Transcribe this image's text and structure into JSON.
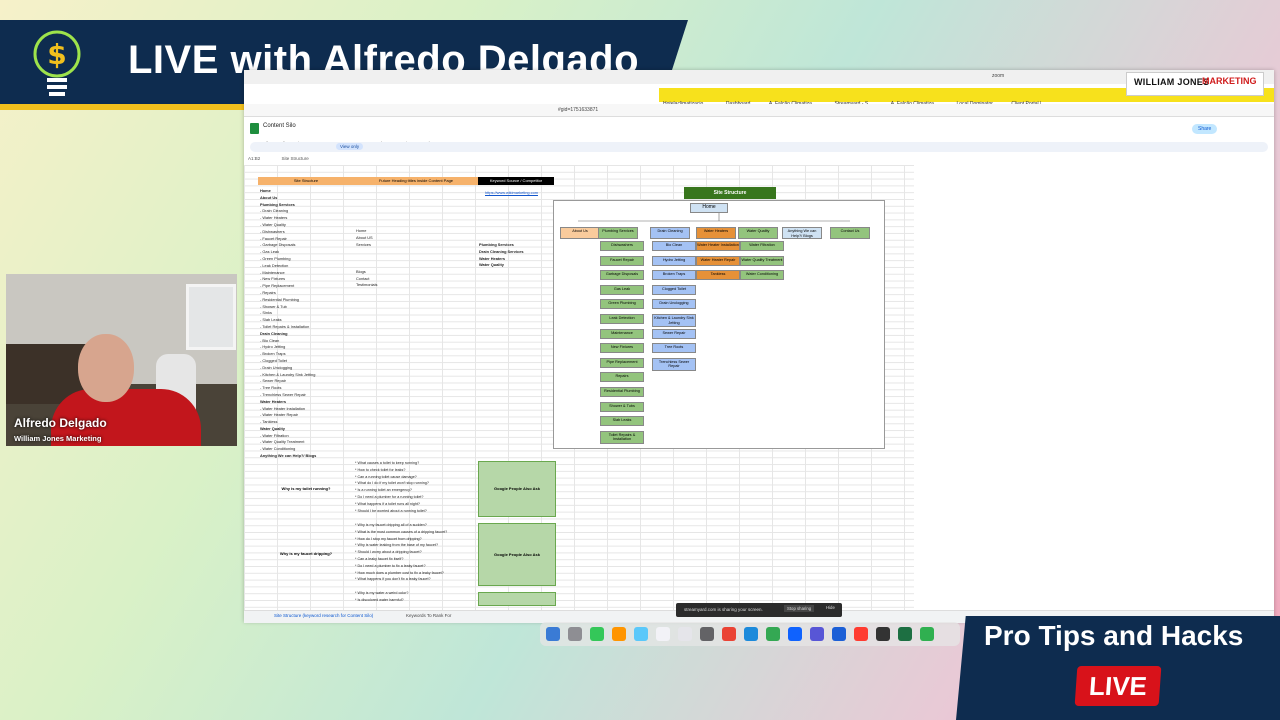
{
  "banner": {
    "title": "LIVE with Alfredo Delgado"
  },
  "logo_corner": {
    "text1": "WILLIAM JONES",
    "text2": "MARKETING"
  },
  "browser": {
    "tabs": [
      "Hotelaclimatizacio...",
      "Dashboard",
      "A. Falcão Climatiza...",
      "Streamyard - S...",
      "A. Falcão Climatiza...",
      "Local Dominator",
      "Client Portal |"
    ],
    "url": "#gid=1751633871",
    "zoom_label": "zoom"
  },
  "sheet": {
    "title": "Content Silo",
    "menus": [
      "File",
      "Edit",
      "View",
      "Insert",
      "Format",
      "Data",
      "Tools",
      "Extensions",
      "Help"
    ],
    "view_mode": "View only",
    "share": "Share",
    "cell_ref": "A1:B2",
    "formula": "Site Structure",
    "header_a": "Site Structure",
    "header_b": "Future Heading titles inside Content Page",
    "header_c": "Keyword Source / Competitor",
    "link_c": "https://www.wikimarketing.com",
    "rows": [
      "Home",
      "About Us",
      "Plumbing Services",
      "- Drain Cleaning",
      "- Water Heaters",
      "- Water Quality",
      "- Dishwashers",
      "- Faucet Repair",
      "- Garbage Disposals",
      "- Gas Leak",
      "- Green Plumbing",
      "- Leak Detection",
      "- Maintenance",
      "- New Fixtures",
      "- Pipe Replacement",
      "- Repairs",
      "- Residential Plumbing",
      "- Shower & Tub",
      "- Sinks",
      "- Slab Leaks",
      "- Toilet Repairs & Installation",
      "Drain Cleaning",
      "- Bio Clean",
      "- Hydro Jetting",
      "- Broken Traps",
      "- Clogged Toilet",
      "- Drain Unclogging",
      "- Kitchen & Laundry Sink Jetting",
      "- Sewer Repair",
      "- Tree Roots",
      "- Trenchless Sewer Repair",
      "Water Heaters",
      "- Water Heater Installation",
      "- Water Heater Repair",
      "- Tankless",
      "Water Quality",
      "- Water Filtration",
      "- Water Quality Treatment",
      "- Water Conditioning",
      "Anything We can Help?/ Blogs"
    ],
    "col_b": [
      "Home",
      "About US",
      "Services",
      "",
      "",
      "",
      "Blogs",
      "Contact",
      "Testimonials"
    ],
    "col_c": [
      "Plumbing Services",
      "Drain Cleaning Services",
      "Water Heaters",
      "Water Quality"
    ],
    "sitemap": {
      "title": "Site Structure",
      "home": "Home",
      "top": [
        "About Us",
        "Plumbing Services",
        "Drain Cleaning",
        "Water Heaters",
        "Water Quality",
        "Anything We can Help?/ Blogs",
        "Contact Us"
      ],
      "plumbing": [
        "Dishwashers",
        "Faucet Repair",
        "Garbage Disposals",
        "Gas Leak",
        "Green Plumbing",
        "Leak Detection",
        "Maintenance",
        "New Fixtures",
        "Pipe Replacement",
        "Repairs",
        "Residential Plumbing",
        "Shower & Tubs",
        "Slab Leaks",
        "Toilet Repairs & Installation"
      ],
      "drain": [
        "Bio Clean",
        "Hydro Jetting",
        "Broken Traps",
        "Clogged Toilet",
        "Drain Unclogging",
        "Kitchen & Laundry Sink Jetting",
        "Sewer Repair",
        "Tree Roots",
        "Trenchless Sewer Repair"
      ],
      "heaters": [
        "Water Heater Installation",
        "Water Heater Repair",
        "Tankless"
      ],
      "quality": [
        "Water Filtration",
        "Water Quality Treatment",
        "Water Conditioning"
      ]
    },
    "faq1": {
      "question": "Why is my toilet running?",
      "source": "Google People Also Ask",
      "items": [
        "* What causes a toilet to keep running?",
        "* How to check toilet for leaks?",
        "* Can a running toilet cause damage?",
        "* What do I do if my toilet won't stop running?",
        "* Is a running toilet an emergency?",
        "* Do I need a plumber for a running toilet?",
        "* What happens if a toilet runs all night?",
        "* Should I be worried about a running toilet?"
      ]
    },
    "faq2": {
      "question": "Why is my faucet dripping?",
      "source": "Google People Also Ask",
      "items": [
        "* Why is my faucet dripping all of a sudden?",
        "* What is the most common causes of a dripping faucet?",
        "* How do I stop my faucet from dripping?",
        "* Why is water leaking from the base of my faucet?",
        "* Should I worry about a dripping faucet?",
        "* Can a leaky faucet fix itself?",
        "* Do I need a plumber to fix a leaky faucet?",
        "* How much does a plumber cost to fix a leaky faucet?",
        "* What happens if you don't fix a leaky faucet?"
      ]
    },
    "faq3": {
      "items": [
        "* Why is my water a weird color?",
        "* Is discolored water harmful?"
      ]
    },
    "bottom_tabs": [
      "Site Structure (keyword research for Content Silo)",
      "Keywords To Rank For"
    ]
  },
  "screen_share": {
    "text": "streamyard.com is sharing your screen.",
    "stop": "Stop sharing",
    "hide": "Hide"
  },
  "webcam": {
    "name": "Alfredo Delgado",
    "company": "William Jones Marketing"
  },
  "promo": {
    "title": "Pro Tips and Hacks",
    "badge": "LIVE"
  },
  "colors": {
    "navy": "#0e2c4f",
    "gold": "#f2c01d",
    "red": "#d8121a",
    "sheet_green": "#38761d"
  }
}
